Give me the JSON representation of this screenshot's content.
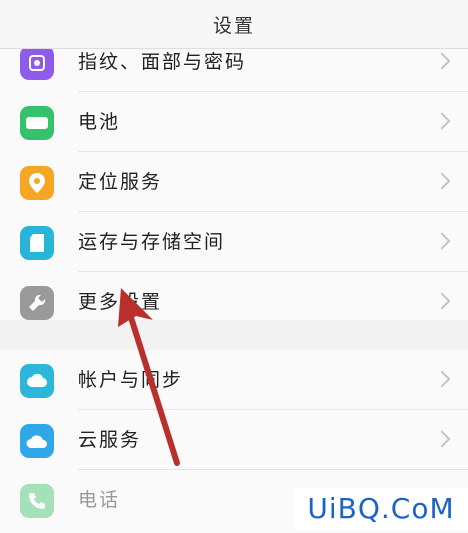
{
  "header": {
    "title": "设置"
  },
  "group1": {
    "items": [
      {
        "label": "指纹、面部与密码",
        "icon": "fingerprint-icon",
        "color": "#8e5bea"
      },
      {
        "label": "电池",
        "icon": "battery-icon",
        "color": "#35c26a"
      },
      {
        "label": "定位服务",
        "icon": "location-pin-icon",
        "color": "#f5a623"
      },
      {
        "label": "运存与存储空间",
        "icon": "sd-card-icon",
        "color": "#27b5d8"
      },
      {
        "label": "更多设置",
        "icon": "wrench-icon",
        "color": "#9a9a9a"
      }
    ]
  },
  "group2": {
    "items": [
      {
        "label": "帐户与同步",
        "icon": "account-sync-icon",
        "color": "#2cb6d9"
      },
      {
        "label": "云服务",
        "icon": "cloud-icon",
        "color": "#2fa7e8"
      },
      {
        "label": "电话",
        "icon": "phone-icon",
        "color": "#3dc36b"
      }
    ]
  },
  "watermark": {
    "text": "UiBQ.CoM"
  }
}
